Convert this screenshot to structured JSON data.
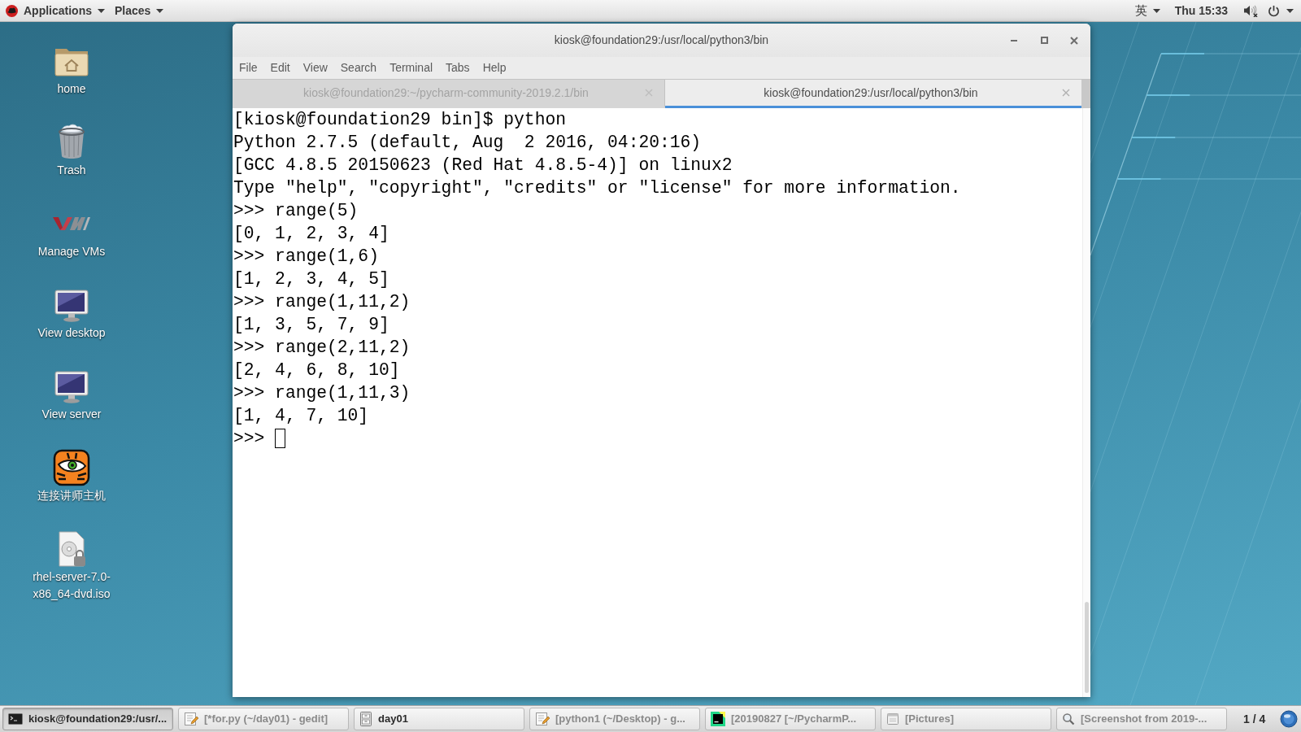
{
  "top_bar": {
    "menus": [
      {
        "kind": "apps",
        "label": "Applications"
      },
      {
        "kind": "places",
        "label": "Places"
      }
    ],
    "input_method": "英",
    "clock": "Thu 15:33",
    "volume": {
      "muted": true
    }
  },
  "desktop_icons": [
    {
      "kind": "home",
      "label": "home"
    },
    {
      "kind": "trash",
      "label": "Trash"
    },
    {
      "kind": "vm",
      "label": "Manage VMs"
    },
    {
      "kind": "monitor",
      "label": "View desktop"
    },
    {
      "kind": "monitor",
      "label": "View server"
    },
    {
      "kind": "tiger",
      "label": "连接讲师主机"
    },
    {
      "kind": "disc",
      "label": "rhel-server-7.0-x86_64-dvd.iso"
    }
  ],
  "terminal": {
    "title": "kiosk@foundation29:/usr/local/python3/bin",
    "menu": [
      "File",
      "Edit",
      "View",
      "Search",
      "Terminal",
      "Tabs",
      "Help"
    ],
    "tabs": [
      {
        "label": "kiosk@foundation29:~/pycharm-community-2019.2.1/bin",
        "selected": false
      },
      {
        "label": "kiosk@foundation29:/usr/local/python3/bin",
        "selected": true
      }
    ],
    "lines": [
      "[kiosk@foundation29 bin]$ python",
      "Python 2.7.5 (default, Aug  2 2016, 04:20:16)",
      "[GCC 4.8.5 20150623 (Red Hat 4.8.5-4)] on linux2",
      "Type \"help\", \"copyright\", \"credits\" or \"license\" for more information.",
      ">>> range(5)",
      "[0, 1, 2, 3, 4]",
      ">>> range(1,6)",
      "[1, 2, 3, 4, 5]",
      ">>> range(1,11,2)",
      "[1, 3, 5, 7, 9]",
      ">>> range(2,11,2)",
      "[2, 4, 6, 8, 10]",
      ">>> range(1,11,3)",
      "[1, 4, 7, 10]"
    ],
    "prompt": ">>>"
  },
  "taskbar": {
    "items": [
      {
        "kind": "terminal",
        "label": "kiosk@foundation29:/usr/...",
        "minimized": false,
        "selected": true
      },
      {
        "kind": "editor",
        "label": "[*for.py (~/day01) - gedit]",
        "minimized": true,
        "selected": false
      },
      {
        "kind": "cabinet",
        "label": "day01",
        "minimized": false,
        "selected": false
      },
      {
        "kind": "editor",
        "label": "[python1 (~/Desktop) - g...",
        "minimized": true,
        "selected": false
      },
      {
        "kind": "pycharm",
        "label": "[20190827 [~/PycharmP...",
        "minimized": true,
        "selected": false
      },
      {
        "kind": "window",
        "label": "[Pictures]",
        "minimized": true,
        "selected": false
      },
      {
        "kind": "viewer",
        "label": "[Screenshot from 2019-...",
        "minimized": true,
        "selected": false
      }
    ],
    "workspace": "1 / 4"
  }
}
